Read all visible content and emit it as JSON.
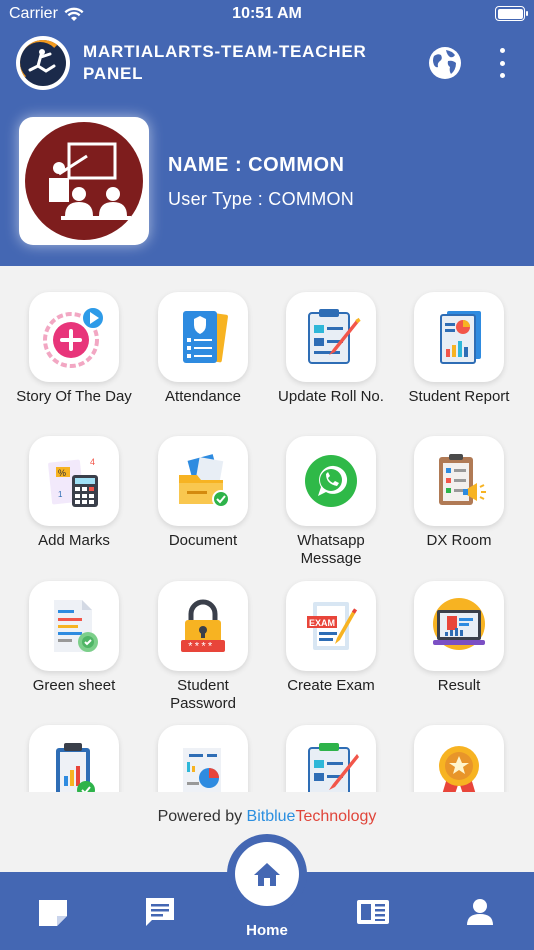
{
  "status_bar": {
    "carrier": "Carrier",
    "time": "10:51 AM"
  },
  "header": {
    "app_title": "MARTIALARTS-TEAM-TEACHER PANEL",
    "profile_name": "NAME : COMMON",
    "user_type": "User Type : COMMON",
    "accent_color": "#4467b3"
  },
  "menu": [
    {
      "label": "Story Of The Day",
      "icon": "story-icon"
    },
    {
      "label": "Attendance",
      "icon": "attendance-icon"
    },
    {
      "label": "Update Roll No.",
      "icon": "edit-clipboard-icon"
    },
    {
      "label": "Student Report",
      "icon": "report-icon"
    },
    {
      "label": "Add Marks",
      "icon": "calculator-icon"
    },
    {
      "label": "Document",
      "icon": "folder-icon"
    },
    {
      "label": "Whatsapp Message",
      "icon": "whatsapp-icon"
    },
    {
      "label": "DX Room",
      "icon": "dx-room-icon"
    },
    {
      "label": "Green sheet",
      "icon": "green-sheet-icon"
    },
    {
      "label": "Student Password",
      "icon": "lock-icon"
    },
    {
      "label": "Create Exam",
      "icon": "exam-icon"
    },
    {
      "label": "Result",
      "icon": "result-icon"
    },
    {
      "label": "",
      "icon": "clipboard-chart-icon"
    },
    {
      "label": "",
      "icon": "analytics-icon"
    },
    {
      "label": "",
      "icon": "clipboard-pencil-icon"
    },
    {
      "label": "",
      "icon": "award-icon"
    }
  ],
  "footer": {
    "powered_prefix": "Powered by ",
    "brand_part1": "Bitblue",
    "brand_part2": "Technology"
  },
  "bottom_nav": {
    "home_label": "Home"
  }
}
